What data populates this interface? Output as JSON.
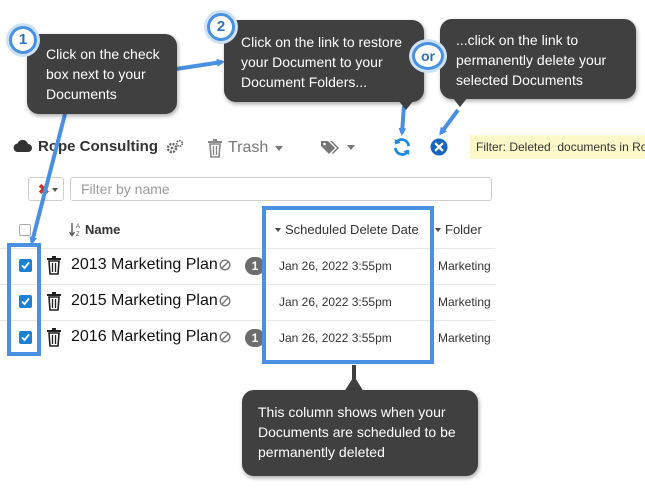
{
  "toolbar": {
    "account_name": "Rope Consulting",
    "trash_label": "Trash",
    "filter_note": "Filter: Deleted  documents in Ro"
  },
  "filter": {
    "placeholder": "Filter by name"
  },
  "table": {
    "columns": {
      "name": "Name",
      "scheduled": "Scheduled Delete Date",
      "folder": "Folder"
    },
    "rows": [
      {
        "name": "2013 Marketing Plan",
        "badge": "1",
        "date": "Jan 26, 2022 3:55pm",
        "folder": "Marketing",
        "checked": true
      },
      {
        "name": "2015 Marketing Plan",
        "badge": "",
        "date": "Jan 26, 2022 3:55pm",
        "folder": "Marketing",
        "checked": true
      },
      {
        "name": "2016 Marketing Plan",
        "badge": "1",
        "date": "Jan 26, 2022 3:55pm",
        "folder": "Marketing",
        "checked": true
      }
    ]
  },
  "annotations": {
    "step1": {
      "number": "1",
      "text": "Click on the check box next to your Documents"
    },
    "step2": {
      "number": "2",
      "text": "Click on the link to restore your Document to your Document Folders..."
    },
    "or": {
      "label": "or",
      "text": "...click on the link to permanently delete your selected Documents"
    },
    "column_note": "This column shows when your Documents are scheduled to be permanently deleted"
  },
  "colors": {
    "accent_blue": "#4a90e2",
    "callout_bg": "#404040",
    "checkbox_blue": "#1e7fd6",
    "delete_blue": "#1565c0",
    "filter_note_bg": "#fcf8c9"
  }
}
